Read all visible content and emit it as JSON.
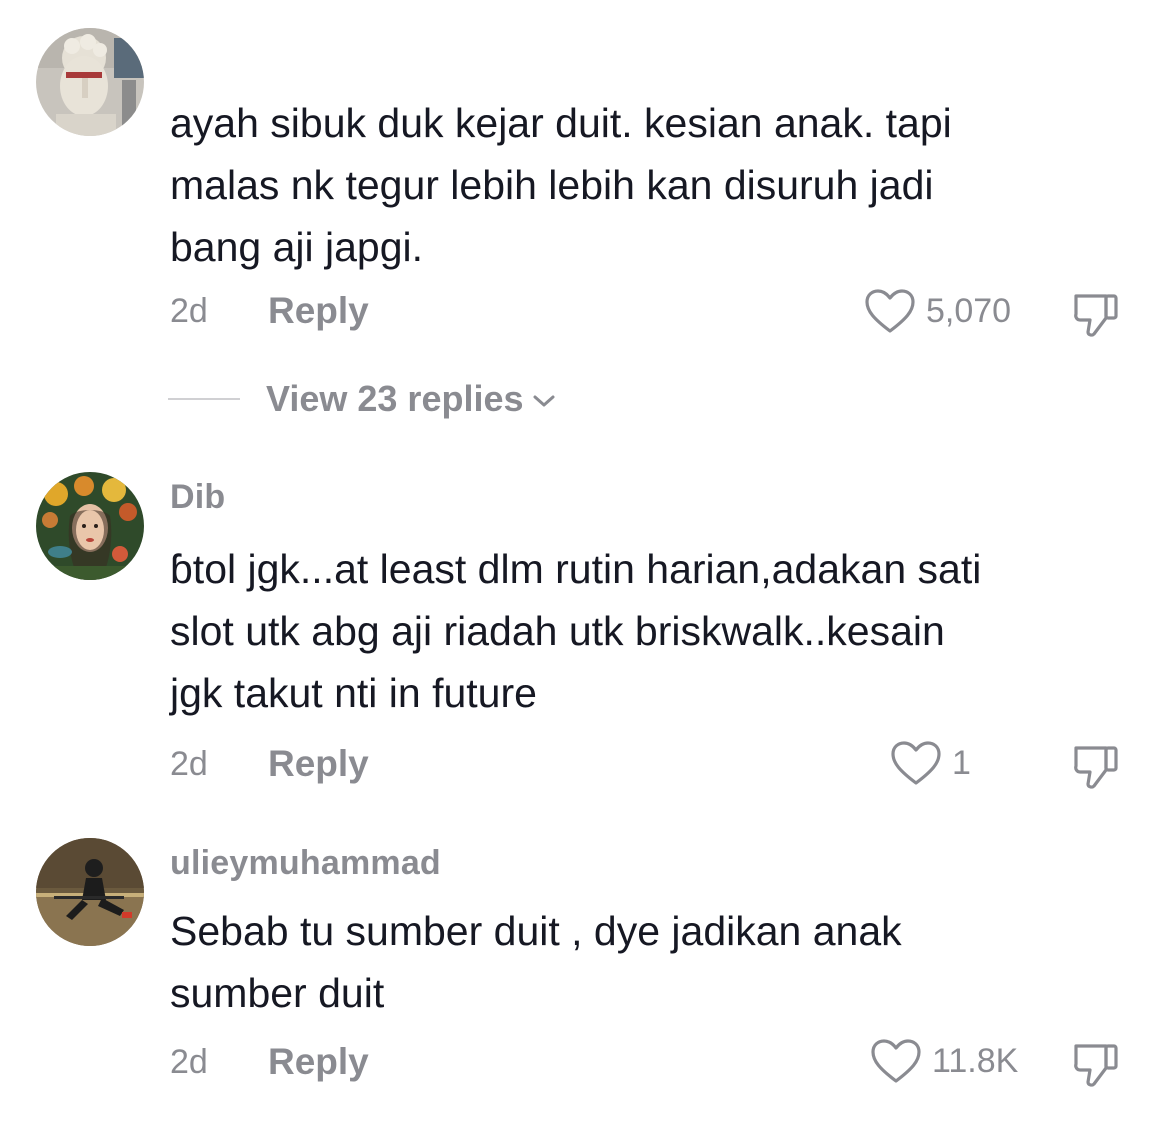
{
  "comments": [
    {
      "username": "",
      "text": "ayah sibuk duk kejar duit. kesian anak. tapi\nmalas nk tegur lebih lebih kan disuruh jadi\nbang aji japgi.",
      "age": "2d",
      "reply_label": "Reply",
      "likes": "5,070",
      "avatar_icon": "statue-avatar-icon"
    },
    {
      "username": "Dib",
      "text": "ɓtol jgk...at least dlm rutin harian,adakan sati\nslot utk abg aji riadah utk briskwalk..kesain\njgk takut nti in future",
      "age": "2d",
      "reply_label": "Reply",
      "likes": "1",
      "avatar_icon": "flower-woman-avatar-icon"
    },
    {
      "username": "ulieymuhammad",
      "text": "Sebab tu sumber duit , dye jadikan anak\nsumber duit",
      "age": "2d",
      "reply_label": "Reply",
      "likes": "11.8K",
      "avatar_icon": "person-avatar-icon"
    }
  ],
  "view_replies": {
    "label": "View 23 replies"
  },
  "colors": {
    "text": "#161823",
    "muted": "#8a8b91",
    "background": "#ffffff"
  }
}
